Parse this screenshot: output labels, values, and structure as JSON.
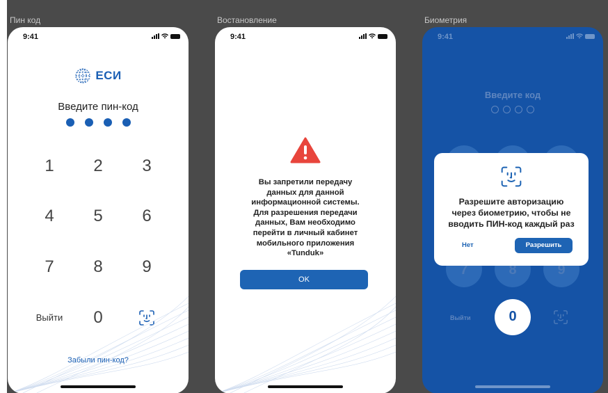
{
  "frames": {
    "pin": {
      "label": "Пин код",
      "status_time": "9:41",
      "logo_text": "ЕСИ",
      "title": "Введите пин-код",
      "keys": [
        "1",
        "2",
        "3",
        "4",
        "5",
        "6",
        "7",
        "8",
        "9",
        "0"
      ],
      "exit_label": "Выйти",
      "forgot_link": "Забыли пин-код?"
    },
    "recovery": {
      "label": "Востановление",
      "status_time": "9:41",
      "message_lines": [
        "Вы запретили передачу",
        "данных для данной",
        "информационной системы.",
        "Для разрешения передачи",
        "данных, Вам необходимо",
        "перейти в личный кабинет",
        "мобильного приложения",
        "«Tunduk»"
      ],
      "ok_label": "OK"
    },
    "biometry": {
      "label": "Биометрия",
      "status_time": "9:41",
      "bg_title": "Введите код",
      "bg_keys": [
        "7",
        "8",
        "9",
        "0"
      ],
      "bg_exit": "Выйти",
      "dialog": {
        "text_lines": [
          "Разрешите авторизацию",
          "через биометрию, чтобы не",
          "вводить ПИН-код каждый раз"
        ],
        "no_label": "Нет",
        "allow_label": "Разрешить"
      }
    }
  },
  "colors": {
    "brand_blue": "#1a5fb4",
    "button_blue": "#1e64b4",
    "biometry_bg": "#1553a6",
    "warning_red": "#e8453c",
    "canvas_bg": "#4a4a4a"
  }
}
